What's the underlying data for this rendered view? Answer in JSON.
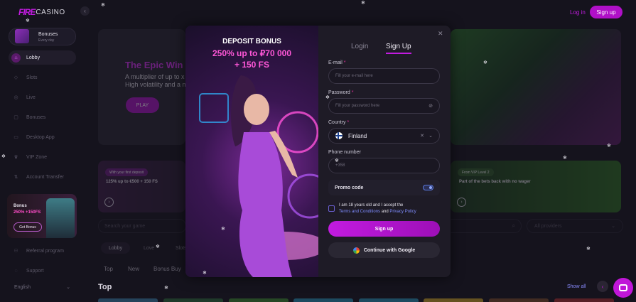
{
  "header": {
    "logo_fire": "FIRE",
    "logo_casino": "CASINO",
    "collapse": "‹",
    "login": "Log in",
    "signup": "Sign up"
  },
  "sidebar": {
    "bonus": {
      "title": "Bonuses",
      "subtitle": "Every day"
    },
    "items": [
      {
        "label": "Lobby",
        "icon": "⌂"
      },
      {
        "label": "Slots",
        "icon": "◇"
      },
      {
        "label": "Live",
        "icon": "◎"
      },
      {
        "label": "Bonuses",
        "icon": "▢"
      },
      {
        "label": "Desktop App",
        "icon": "▭"
      },
      {
        "label": "VIP Zone",
        "icon": "♛"
      },
      {
        "label": "Account Transfer",
        "icon": "⇅"
      }
    ],
    "promo": {
      "title": "Bonus",
      "value": "250% +150FS",
      "button": "Get Bonus"
    },
    "items2": [
      {
        "label": "Referral program",
        "icon": "⚇"
      },
      {
        "label": "Support",
        "icon": "◌"
      }
    ],
    "language": "English",
    "language_chevron": "⌄"
  },
  "main": {
    "hero_title": "The Epic Win",
    "hero_sub1": "A multiplier of up to x",
    "hero_sub2": "High volatility and a n",
    "play": "PLAY",
    "promo_left": {
      "pill": "With your first deposit",
      "text": "125% up to €500 + 150 FS",
      "arrow": "›"
    },
    "promo_right": {
      "pill": "From VIP Level 2",
      "text": "Part of the bets back with no wager",
      "arrow": "›"
    },
    "search_placeholder": "Search your game",
    "search_icon": "⌕",
    "providers": "All providers",
    "providers_chevron": "⌄",
    "tabs": [
      "Lobby",
      "Love",
      "Slots"
    ],
    "subtabs": [
      "Top",
      "New",
      "Bonus Buy"
    ],
    "section_title": "Top",
    "show_all": "Show all",
    "prev": "‹"
  },
  "modal": {
    "image": {
      "line1": "DEPOSIT BONUS",
      "line2": "250% up to ₽70 000",
      "line3": "+ 150 FS"
    },
    "close": "✕",
    "tab_login": "Login",
    "tab_signup": "Sign Up",
    "email_label": "E-mail",
    "email_placeholder": "Fill your e-mail here",
    "password_label": "Password",
    "password_placeholder": "Fill your password here",
    "password_toggle": "⊘",
    "country_label": "Country",
    "country_value": "Finland",
    "country_clear": "✕",
    "country_chevron": "⌄",
    "phone_label": "Phone number",
    "phone_value": "+358",
    "required_mark": "*",
    "promo_code": "Promo code",
    "agree_text1": "I am 18 years old and I accept the",
    "agree_terms": "Terms and Conditions",
    "agree_and": "and",
    "agree_privacy": "Privacy Policy",
    "submit": "Sign up",
    "google": "Continue with Google"
  },
  "colors": {
    "accent": "#c21be0",
    "background": "#15131d",
    "modal_bg": "#1e1b26",
    "link": "#7f8cff"
  },
  "icons": {
    "chat": "chat-icon",
    "snowflake": "❄"
  }
}
